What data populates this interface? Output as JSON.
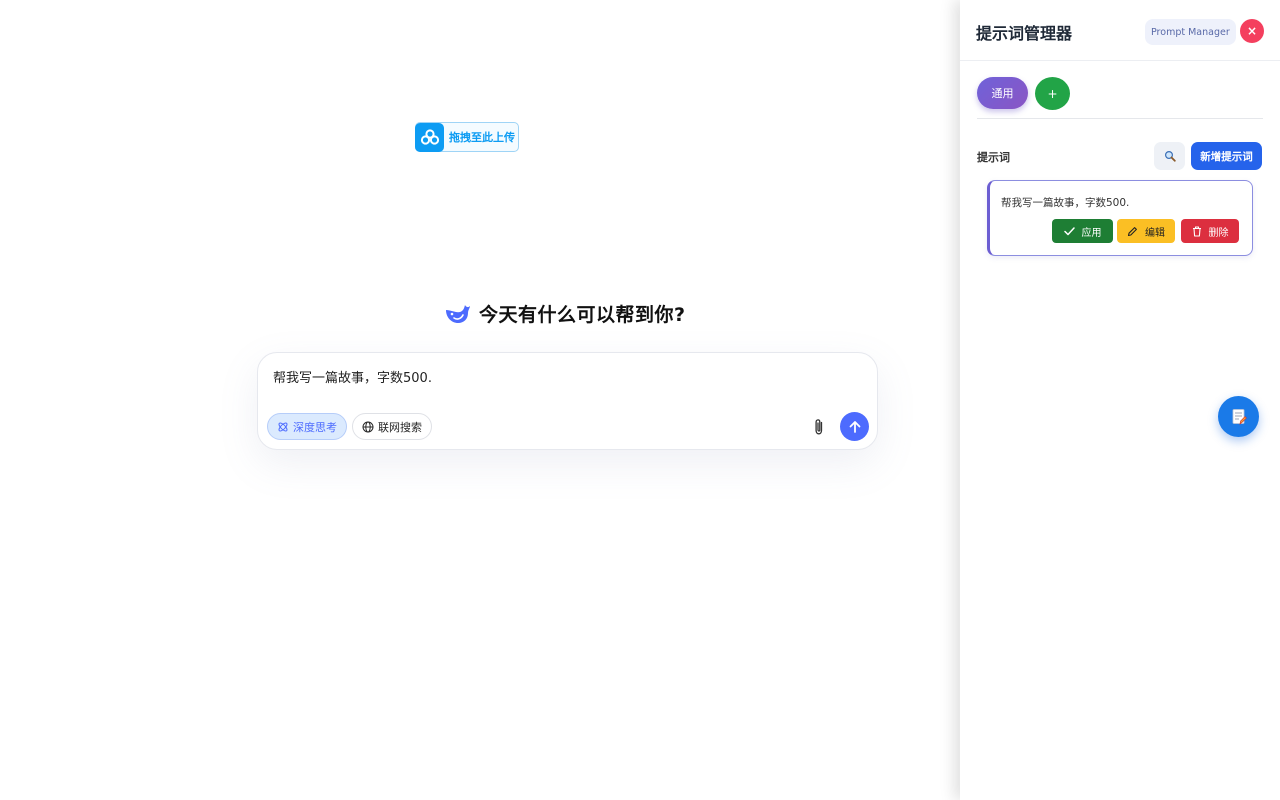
{
  "upload": {
    "label": "拖拽至此上传",
    "icon": "cloud-upload-icon"
  },
  "welcome": {
    "title": "今天有什么可以帮到你?",
    "icon": "deepseek-whale-icon"
  },
  "composer": {
    "text": "帮我写一篇故事，字数500.",
    "deep_think": "深度思考",
    "web_search": "联网搜索",
    "attach_icon": "paperclip-icon",
    "send_icon": "arrow-up-icon"
  },
  "panel": {
    "title": "提示词管理器",
    "tag": "Prompt Manager",
    "close": "×",
    "categories": [
      {
        "label": "通用",
        "active": true
      }
    ],
    "add_category": "+",
    "section_title": "提示词",
    "search_icon": "magnifier-icon",
    "new_prompt": "新增提示词",
    "prompts": [
      {
        "text": "帮我写一篇故事，字数500.",
        "apply": "应用",
        "edit": "编辑",
        "delete": "删除"
      }
    ]
  },
  "fab": {
    "icon": "notepad-icon"
  },
  "colors": {
    "accent": "#4d6bfe",
    "primary": "#2563eb",
    "success": "#1e7e34",
    "warning": "#fbbf24",
    "danger": "#dc2f3f",
    "close": "#f43f5e"
  }
}
